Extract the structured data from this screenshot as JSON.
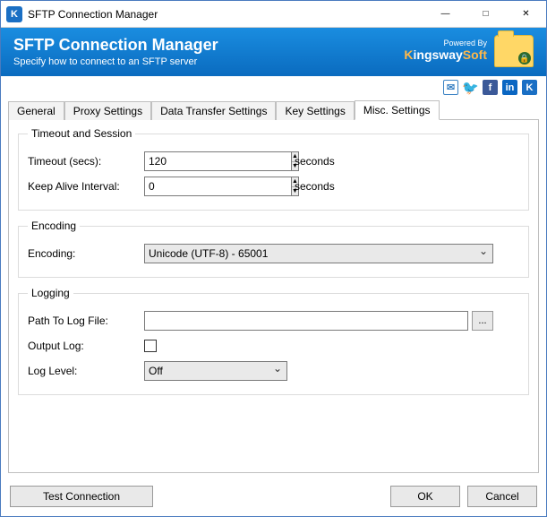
{
  "window": {
    "title": "SFTP Connection Manager"
  },
  "banner": {
    "title": "SFTP Connection Manager",
    "subtitle": "Specify how to connect to an SFTP server",
    "powered_by": "Powered By",
    "vendor_k": "K",
    "vendor_ingsway": "ingsway",
    "vendor_soft": "Soft"
  },
  "social": {
    "mail": "✉",
    "twitter": "🐦",
    "facebook": "f",
    "linkedin": "in",
    "k": "K"
  },
  "tabs": {
    "general": "General",
    "proxy": "Proxy Settings",
    "data": "Data Transfer Settings",
    "key": "Key Settings",
    "misc": "Misc. Settings"
  },
  "groups": {
    "timeout": {
      "legend": "Timeout and Session",
      "timeout_label": "Timeout (secs):",
      "timeout_value": "120",
      "keepalive_label": "Keep Alive Interval:",
      "keepalive_value": "0",
      "seconds": "seconds"
    },
    "encoding": {
      "legend": "Encoding",
      "label": "Encoding:",
      "value": "Unicode (UTF-8) - 65001"
    },
    "logging": {
      "legend": "Logging",
      "path_label": "Path To Log File:",
      "path_value": "",
      "browse": "...",
      "output_label": "Output Log:",
      "output_checked": false,
      "level_label": "Log Level:",
      "level_value": "Off"
    }
  },
  "footer": {
    "test": "Test Connection",
    "ok": "OK",
    "cancel": "Cancel"
  }
}
